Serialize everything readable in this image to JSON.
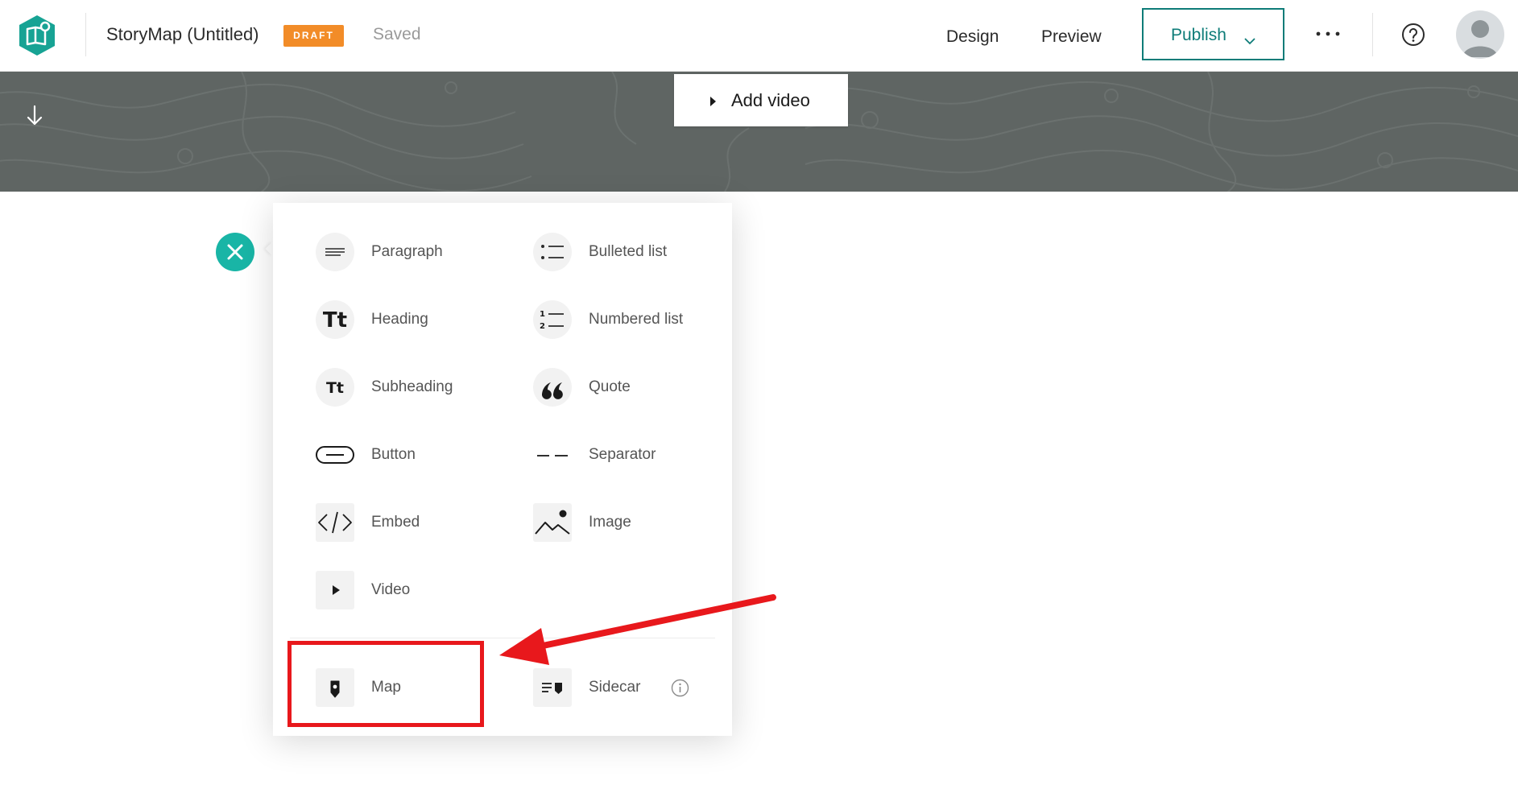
{
  "header": {
    "title": "StoryMap (Untitled)",
    "draft_badge": "DRAFT",
    "save_status": "Saved",
    "nav": {
      "design": "Design",
      "preview": "Preview"
    },
    "publish_label": "Publish"
  },
  "banner": {
    "add_video_label": "Add video"
  },
  "block_menu": {
    "items": [
      {
        "label": "Paragraph",
        "icon": "paragraph-icon"
      },
      {
        "label": "Bulleted list",
        "icon": "bulleted-list-icon"
      },
      {
        "label": "Heading",
        "icon": "heading-icon"
      },
      {
        "label": "Numbered list",
        "icon": "numbered-list-icon"
      },
      {
        "label": "Subheading",
        "icon": "subheading-icon"
      },
      {
        "label": "Quote",
        "icon": "quote-icon"
      },
      {
        "label": "Button",
        "icon": "button-icon"
      },
      {
        "label": "Separator",
        "icon": "separator-icon"
      },
      {
        "label": "Embed",
        "icon": "embed-icon"
      },
      {
        "label": "Image",
        "icon": "image-icon"
      },
      {
        "label": "Video",
        "icon": "video-icon"
      }
    ],
    "immersive_items": [
      {
        "label": "Map",
        "icon": "map-pin-icon"
      },
      {
        "label": "Sidecar",
        "icon": "sidecar-icon"
      }
    ]
  },
  "colors": {
    "brand_teal": "#0e7c78",
    "accent_teal": "#19b5a6",
    "draft_orange": "#f28c28",
    "annotation_red": "#e8181c",
    "banner_gray": "#5f6563"
  }
}
